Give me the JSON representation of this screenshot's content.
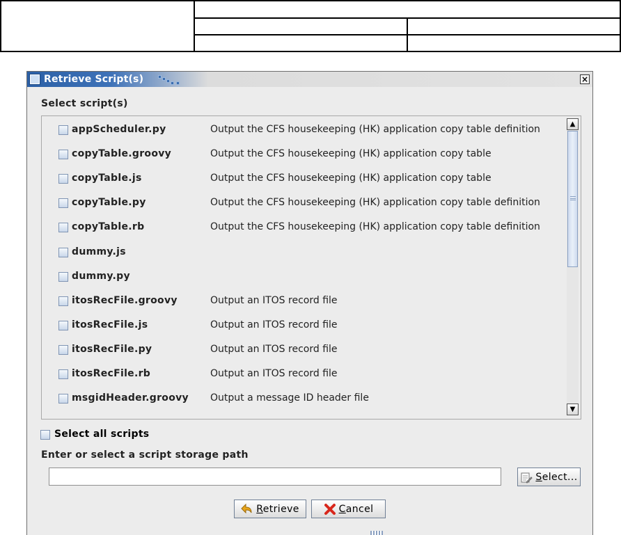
{
  "dialog": {
    "title": "Retrieve Script(s)",
    "close_glyph": "×",
    "select_scripts_label": "Select script(s)",
    "scripts": [
      {
        "name": "appScheduler.py",
        "description": "Output the CFS housekeeping (HK) application copy table definition"
      },
      {
        "name": "copyTable.groovy",
        "description": "Output the CFS housekeeping (HK) application copy table"
      },
      {
        "name": "copyTable.js",
        "description": "Output the CFS housekeeping (HK) application copy table"
      },
      {
        "name": "copyTable.py",
        "description": "Output the CFS housekeeping (HK) application copy table definition"
      },
      {
        "name": "copyTable.rb",
        "description": "Output the CFS housekeeping (HK) application copy table definition"
      },
      {
        "name": "dummy.js",
        "description": ""
      },
      {
        "name": "dummy.py",
        "description": ""
      },
      {
        "name": "itosRecFile.groovy",
        "description": "Output an ITOS record file"
      },
      {
        "name": "itosRecFile.js",
        "description": "Output an ITOS record file"
      },
      {
        "name": "itosRecFile.py",
        "description": "Output an ITOS record file"
      },
      {
        "name": "itosRecFile.rb",
        "description": "Output an ITOS record file"
      },
      {
        "name": "msgidHeader.groovy",
        "description": "Output a message ID header file"
      }
    ],
    "select_all_label": "Select all scripts",
    "path_label": "Enter or select a script storage path",
    "path_value": "",
    "select_button": {
      "first": "S",
      "rest": "elect..."
    },
    "retrieve_button": {
      "first": "R",
      "rest": "etrieve"
    },
    "cancel_button": {
      "first": "C",
      "rest": "ancel"
    }
  },
  "icons": {
    "window": "window-icon",
    "close": "close-icon",
    "select": "folder-browse-icon",
    "retrieve": "retrieve-arrow-icon",
    "cancel": "red-x-icon"
  },
  "colors": {
    "title_bar": "#2c60a6",
    "dialog_bg": "#ececec",
    "checkbox_border": "#7f94b3",
    "cancel_icon": "#d8271c",
    "retrieve_icon": "#e8a51a"
  }
}
